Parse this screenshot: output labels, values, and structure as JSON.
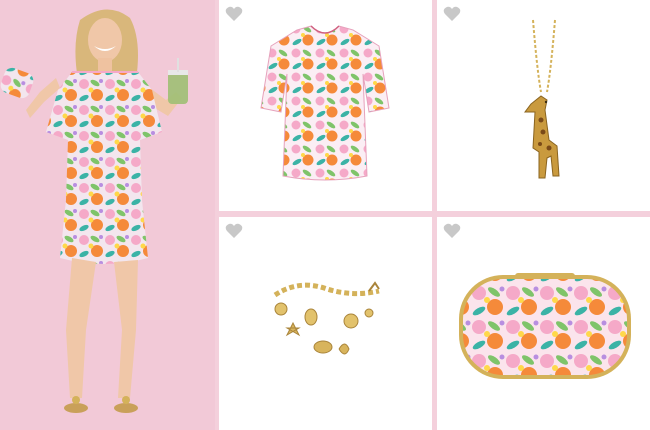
{
  "layout": {
    "columns": 3,
    "background": "#f4d0dc"
  },
  "hero": {
    "icon": "model-photo",
    "items": [
      "printed-shift-dress",
      "floral-clutch",
      "green-drink"
    ]
  },
  "products": [
    {
      "icon": "printed-shift-dress",
      "favorite_icon": "heart-icon",
      "favorited": false
    },
    {
      "icon": "giraffe-pendant-necklace",
      "favorite_icon": "heart-icon",
      "favorited": false
    },
    {
      "icon": "gold-charm-bracelet",
      "favorite_icon": "heart-icon",
      "favorited": false
    },
    {
      "icon": "floral-clutch",
      "favorite_icon": "heart-icon",
      "favorited": false
    }
  ],
  "colors": {
    "heart": "#c8c8c8",
    "tile_bg": "#ffffff",
    "print_pink": "#f5a9c8",
    "print_green": "#7fc46a",
    "print_orange": "#f58a3a",
    "gold": "#d4b25a"
  }
}
